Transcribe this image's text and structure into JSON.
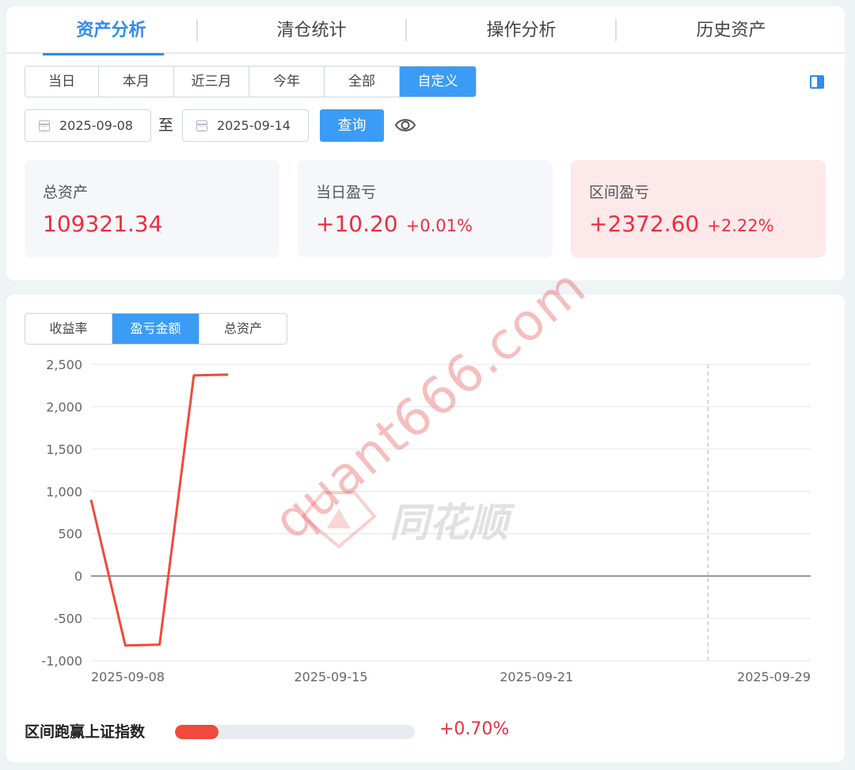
{
  "main_tabs": [
    {
      "label": "资产分析",
      "active": true
    },
    {
      "label": "清仓统计",
      "active": false
    },
    {
      "label": "操作分析",
      "active": false
    },
    {
      "label": "历史资产",
      "active": false
    }
  ],
  "periods": [
    {
      "label": "当日",
      "active": false
    },
    {
      "label": "本月",
      "active": false
    },
    {
      "label": "近三月",
      "active": false
    },
    {
      "label": "今年",
      "active": false
    },
    {
      "label": "全部",
      "active": false
    },
    {
      "label": "自定义",
      "active": true
    }
  ],
  "date_range": {
    "start": "2025-09-08",
    "separator": "至",
    "end": "2025-09-14",
    "query_label": "查询"
  },
  "stats": {
    "total_assets": {
      "label": "总资产",
      "value": "109321.34"
    },
    "daily_pnl": {
      "label": "当日盈亏",
      "value": "+10.20",
      "pct": "+0.01%"
    },
    "range_pnl": {
      "label": "区间盈亏",
      "value": "+2372.60",
      "pct": "+2.22%"
    }
  },
  "chart_tabs": [
    {
      "label": "收益率",
      "active": false
    },
    {
      "label": "盈亏金额",
      "active": true
    },
    {
      "label": "总资产",
      "active": false
    }
  ],
  "chart_data": {
    "type": "line",
    "x": [
      "2025-09-08",
      "2025-09-09",
      "2025-09-10",
      "2025-09-11",
      "2025-09-12"
    ],
    "series": [
      {
        "values": [
          900,
          -820,
          -810,
          2370,
          2380
        ],
        "color": "#f04a3c"
      }
    ],
    "x_tick_labels": [
      "2025-09-08",
      "2025-09-15",
      "2025-09-21",
      "2025-09-29"
    ],
    "x_range": [
      "2025-09-08",
      "2025-09-29"
    ],
    "y_ticks": [
      2500,
      2000,
      1500,
      1000,
      500,
      0,
      -500,
      -1000
    ],
    "y_tick_labels": [
      "2,500",
      "2,000",
      "1,500",
      "1,000",
      "500",
      "0",
      "-500",
      "-1,000"
    ],
    "ylim": [
      -1000,
      2500
    ],
    "marker_date": "2025-09-26",
    "grid": true
  },
  "watermark": {
    "text": "quant666.com",
    "logo": "同花顺"
  },
  "beat_index": {
    "label": "区间跑赢上证指数",
    "value": "+0.70%",
    "fill_fraction": 0.18
  }
}
